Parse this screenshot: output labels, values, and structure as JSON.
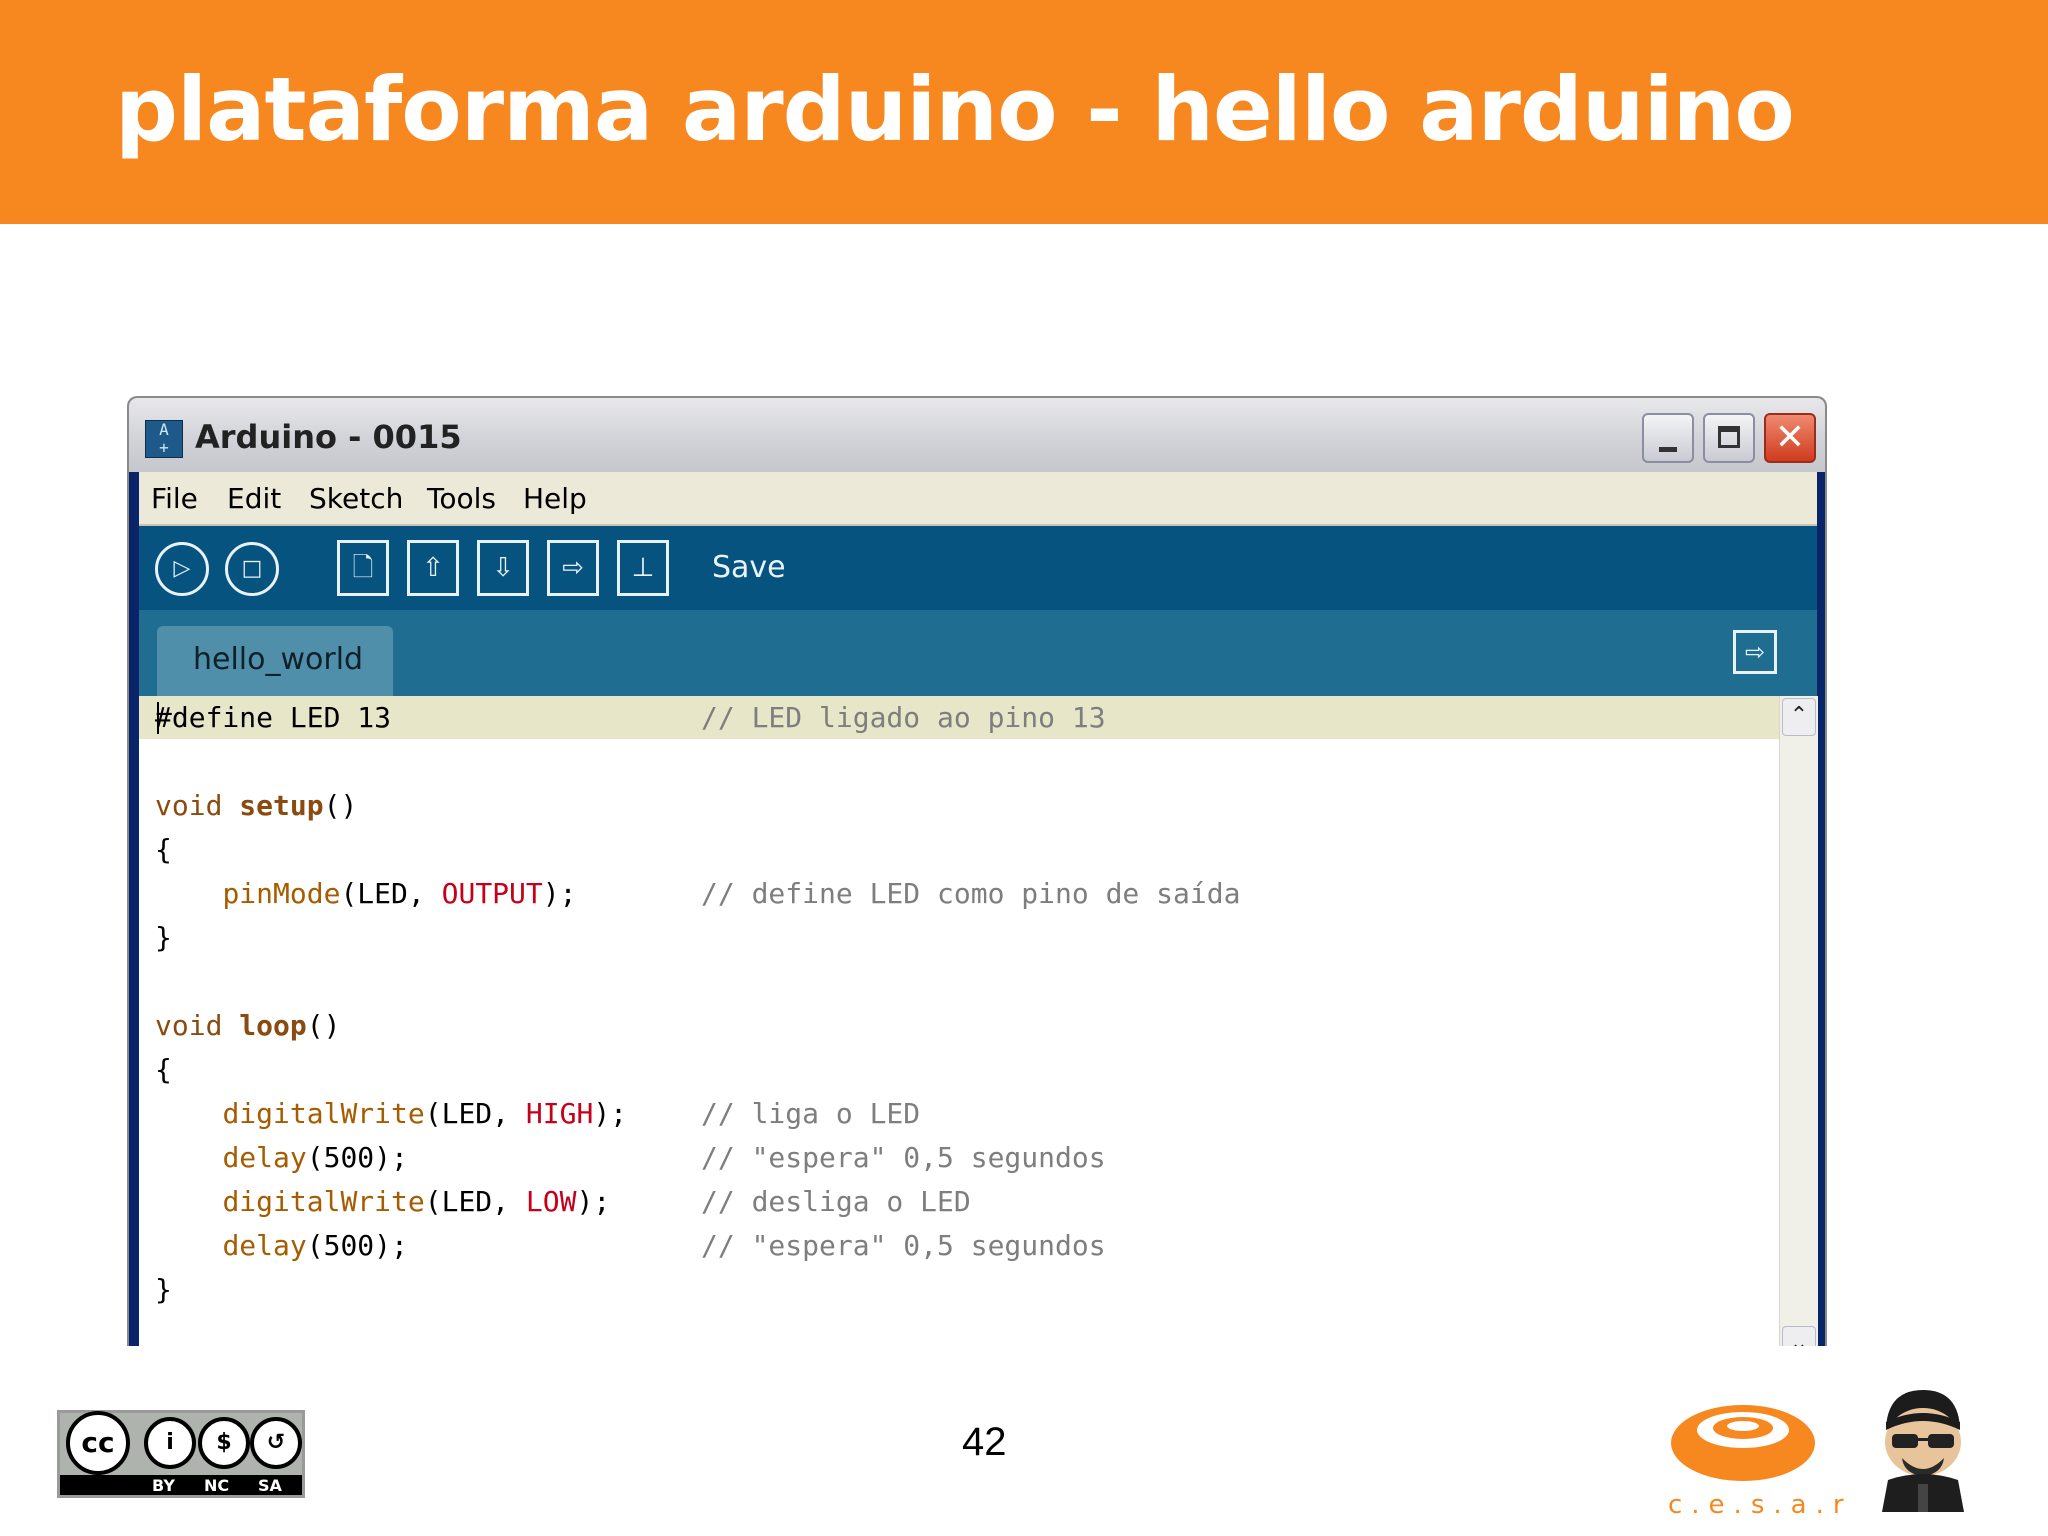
{
  "slide": {
    "title": "plataforma arduino - hello arduino",
    "page_number": "42"
  },
  "window": {
    "title": "Arduino - 0015",
    "controls": [
      "minimize",
      "maximize",
      "close"
    ]
  },
  "menu": [
    "File",
    "Edit",
    "Sketch",
    "Tools",
    "Help"
  ],
  "toolbar": {
    "hover_label": "Save",
    "icons": [
      "verify-icon",
      "stop-icon",
      "new-icon",
      "open-icon",
      "save-icon",
      "upload-icon",
      "serial-monitor-icon"
    ]
  },
  "tabs": [
    {
      "label": "hello_world"
    }
  ],
  "code": {
    "l1": {
      "a": "#define LED 13",
      "cm": "// LED ligado ao pino 13"
    },
    "l3": {
      "kw": "void",
      "fn": "setup",
      "rest": "()"
    },
    "l4": "{",
    "l5": {
      "lib": "pinMode",
      "a": "(LED, ",
      "c": "OUTPUT",
      "b": ");",
      "cm": "// define LED como pino de saída"
    },
    "l6": "}",
    "l8": {
      "kw": "void",
      "fn": "loop",
      "rest": "()"
    },
    "l9": "{",
    "l10": {
      "lib": "digitalWrite",
      "a": "(LED, ",
      "c": "HIGH",
      "b": ");",
      "cm": "// liga o LED"
    },
    "l11": {
      "lib": "delay",
      "a": "(500);",
      "cm": "// \"espera\" 0,5 segundos"
    },
    "l12": {
      "lib": "digitalWrite",
      "a": "(LED, ",
      "c": "LOW",
      "b": ");",
      "cm": "// desliga o LED"
    },
    "l13": {
      "lib": "delay",
      "a": "(500);",
      "cm": "// \"espera\" 0,5 segundos"
    },
    "l14": "}"
  },
  "footer": {
    "cc_labels": [
      "BY",
      "NC",
      "SA"
    ],
    "cc_symbol": "cc",
    "org_name": "c.e.s.a.r"
  },
  "colors": {
    "header_orange": "#f7881f",
    "toolbar_blue": "#065380",
    "tabbar_blue": "#1f6d90"
  }
}
